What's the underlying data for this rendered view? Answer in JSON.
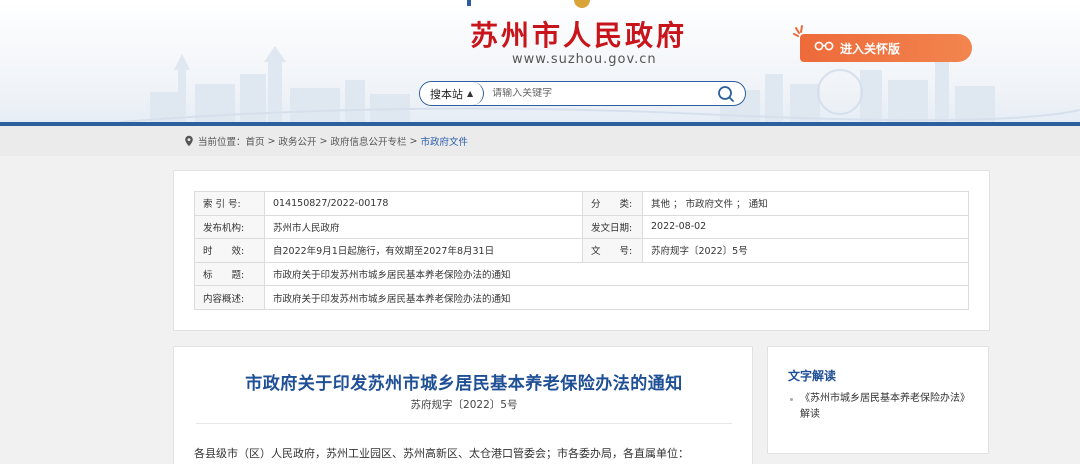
{
  "header": {
    "site_title": "苏州市人民政府",
    "site_url": "www.suzhou.gov.cn",
    "care_mode_label": "进入关怀版",
    "care_mode_icon": "glasses-icon"
  },
  "search": {
    "scope_label": "搜本站",
    "placeholder": "请输入关键字"
  },
  "breadcrumb": {
    "prefix": "当前位置：",
    "items": [
      "首页",
      "政务公开",
      "政府信息公开专栏",
      "市政府文件"
    ],
    "separator": ">"
  },
  "meta": {
    "index_label": "索 引 号:",
    "index_value": "014150827/2022-00178",
    "category_label": "分　　类:",
    "category_value": "其他 ；  市政府文件 ；  通知",
    "publisher_label": "发布机构:",
    "publisher_value": "苏州市人民政府",
    "date_label": "发文日期:",
    "date_value": "2022-08-02",
    "validity_label": "时　　效:",
    "validity_value": "自2022年9月1日起施行，有效期至2027年8月31日",
    "docno_label": "文　　号:",
    "docno_value": "苏府规字〔2022〕5号",
    "title_label": "标　　题:",
    "title_value": "市政府关于印发苏州市城乡居民基本养老保险办法的通知",
    "summary_label": "内容概述:",
    "summary_value": "市政府关于印发苏州市城乡居民基本养老保险办法的通知"
  },
  "article": {
    "title": "市政府关于印发苏州市城乡居民基本养老保险办法的通知",
    "doc_number": "苏府规字〔2022〕5号",
    "body_first_line": "各县级市（区）人民政府，苏州工业园区、苏州高新区、太仓港口管委会；市各委办局，各直属单位："
  },
  "side": {
    "title": "文字解读",
    "items": [
      "《苏州市城乡居民基本养老保险办法》解读"
    ]
  },
  "colors": {
    "brand_red": "#c8141b",
    "brand_blue": "#2d5f9e",
    "title_blue": "#1f4f95",
    "care_orange": "#ee6a3a"
  }
}
